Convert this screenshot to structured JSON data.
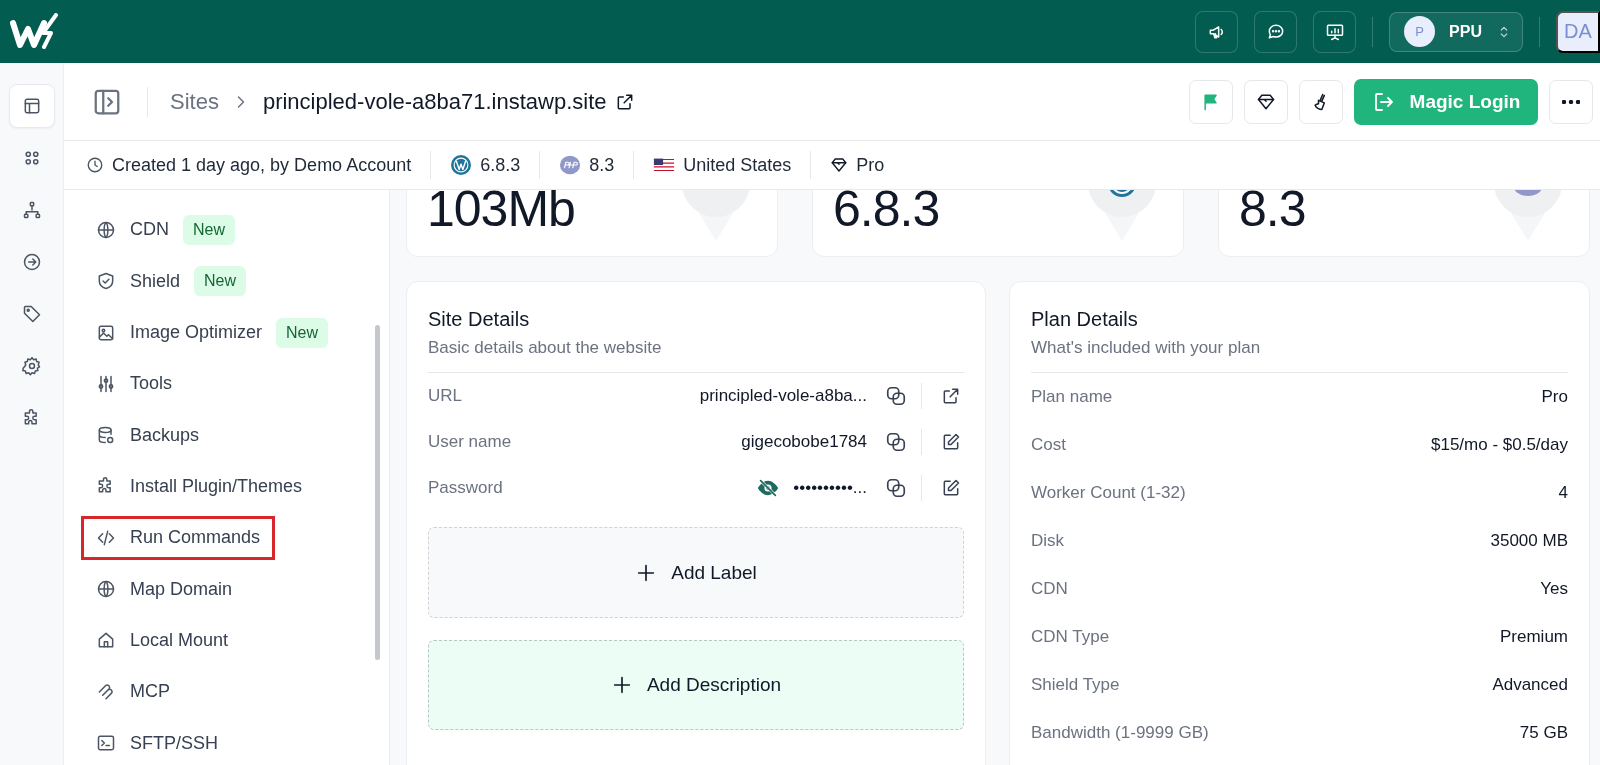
{
  "topbar": {
    "workspace": {
      "initial": "P",
      "name": "PPU"
    },
    "avatar": "DA"
  },
  "rail": [
    {
      "selected": true
    },
    {
      "selected": false
    },
    {
      "selected": false
    },
    {
      "selected": false
    },
    {
      "selected": false
    },
    {
      "selected": false
    },
    {
      "selected": false
    }
  ],
  "breadcrumb": {
    "parent": "Sites",
    "current": "principled-vole-a8ba71.instawp.site"
  },
  "actions": {
    "primary": "Magic Login"
  },
  "info": {
    "created": "Created 1 day ago, by Demo Account",
    "wp_version": "6.8.3",
    "php_version": "8.3",
    "region": "United States",
    "plan": "Pro"
  },
  "nav": [
    {
      "label": "CDN",
      "badge": "New",
      "highlighted": false
    },
    {
      "label": "Shield",
      "badge": "New",
      "highlighted": false
    },
    {
      "label": "Image Optimizer",
      "badge": "New",
      "highlighted": false
    },
    {
      "label": "Tools",
      "highlighted": false
    },
    {
      "label": "Backups",
      "highlighted": false
    },
    {
      "label": "Install Plugin/Themes",
      "highlighted": false
    },
    {
      "label": "Run Commands",
      "highlighted": true
    },
    {
      "label": "Map Domain",
      "highlighted": false
    },
    {
      "label": "Local Mount",
      "highlighted": false
    },
    {
      "label": "MCP",
      "highlighted": false
    },
    {
      "label": "SFTP/SSH",
      "highlighted": false
    }
  ],
  "stats": [
    {
      "value": "103Mb"
    },
    {
      "value": "6.8.3"
    },
    {
      "value": "8.3"
    }
  ],
  "site_details": {
    "title": "Site Details",
    "subtitle": "Basic details about the website",
    "rows": [
      {
        "label": "URL",
        "value": "principled-vole-a8ba...",
        "kind": "link"
      },
      {
        "label": "User name",
        "value": "gigecobobe1784",
        "kind": "edit"
      },
      {
        "label": "Password",
        "value": "••••••••••...",
        "kind": "secret"
      }
    ],
    "add_label": "Add Label",
    "add_description": "Add Description"
  },
  "plan_details": {
    "title": "Plan Details",
    "subtitle": "What's included with your plan",
    "rows": [
      {
        "label": "Plan name",
        "value": "Pro"
      },
      {
        "label": "Cost",
        "value": "$15/mo - $0.5/day"
      },
      {
        "label": "Worker Count (1-32)",
        "value": "4"
      },
      {
        "label": "Disk",
        "value": "35000 MB"
      },
      {
        "label": "CDN",
        "value": "Yes"
      },
      {
        "label": "CDN Type",
        "value": "Premium"
      },
      {
        "label": "Shield Type",
        "value": "Advanced"
      },
      {
        "label": "Bandwidth (1-9999 GB)",
        "value": "75 GB"
      }
    ]
  }
}
